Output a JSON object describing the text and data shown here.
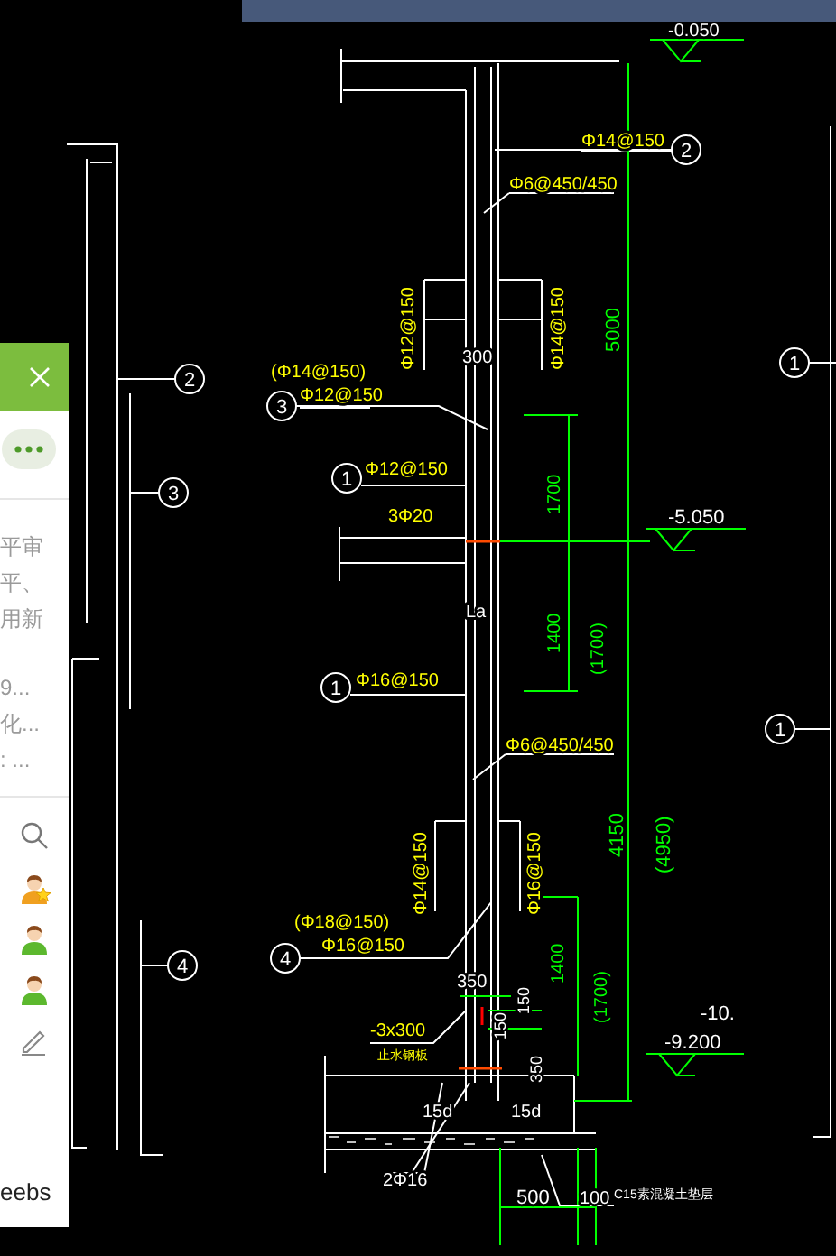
{
  "side_panel": {
    "snippets": [
      "平审",
      "平、",
      "用新",
      "9...",
      "化...",
      ": ..."
    ],
    "contacts": [
      {
        "starred": true
      },
      {
        "starred": false
      },
      {
        "starred": false
      }
    ],
    "footer": "eebs"
  },
  "drawing": {
    "labels": [
      {
        "text": "-0.050",
        "kind": "text"
      },
      {
        "text": "Φ14@150",
        "kind": "rebar"
      },
      {
        "text": "Φ6@450/450",
        "kind": "rebar"
      },
      {
        "text": "Φ12@150",
        "kind": "rebar"
      },
      {
        "text": "Φ14@150",
        "kind": "rebar"
      },
      {
        "text": "5000",
        "kind": "dimension"
      },
      {
        "text": "300",
        "kind": "text"
      },
      {
        "text": "(Φ14@150)",
        "kind": "rebar"
      },
      {
        "text": "Φ12@150",
        "kind": "rebar"
      },
      {
        "text": "Φ12@150",
        "kind": "rebar"
      },
      {
        "text": "3Φ20",
        "kind": "rebar"
      },
      {
        "text": "1700",
        "kind": "dimension"
      },
      {
        "text": "-5.050",
        "kind": "text"
      },
      {
        "text": "La",
        "kind": "text"
      },
      {
        "text": "1400",
        "kind": "dimension"
      },
      {
        "text": "(1700)",
        "kind": "dimension"
      },
      {
        "text": "Φ16@150",
        "kind": "rebar"
      },
      {
        "text": "Φ6@450/450",
        "kind": "rebar"
      },
      {
        "text": "4150",
        "kind": "dimension"
      },
      {
        "text": "(4950)",
        "kind": "dimension"
      },
      {
        "text": "Φ14@150",
        "kind": "rebar"
      },
      {
        "text": "Φ16@150",
        "kind": "rebar"
      },
      {
        "text": "(Φ18@150)",
        "kind": "rebar"
      },
      {
        "text": "Φ16@150",
        "kind": "rebar"
      },
      {
        "text": "1400",
        "kind": "dimension"
      },
      {
        "text": "(1700)",
        "kind": "dimension"
      },
      {
        "text": "350",
        "kind": "text"
      },
      {
        "text": "150",
        "kind": "text"
      },
      {
        "text": "150",
        "kind": "text"
      },
      {
        "text": "350",
        "kind": "text"
      },
      {
        "text": "-3x300",
        "kind": "rebar"
      },
      {
        "text": "止水钢板",
        "kind": "rebar"
      },
      {
        "text": "-10.",
        "kind": "text"
      },
      {
        "text": "-9.200",
        "kind": "text"
      },
      {
        "text": "15d",
        "kind": "text"
      },
      {
        "text": "15d",
        "kind": "text"
      },
      {
        "text": "2Φ16",
        "kind": "text"
      },
      {
        "text": "500",
        "kind": "text"
      },
      {
        "text": "100",
        "kind": "text"
      },
      {
        "text": "C15素混凝土垫层",
        "kind": "text"
      }
    ],
    "callouts": [
      {
        "label": "2"
      },
      {
        "label": "2"
      },
      {
        "label": "1"
      },
      {
        "label": "3"
      },
      {
        "label": "3"
      },
      {
        "label": "1"
      },
      {
        "label": "1"
      },
      {
        "label": "1"
      },
      {
        "label": "4"
      },
      {
        "label": "4"
      }
    ]
  }
}
